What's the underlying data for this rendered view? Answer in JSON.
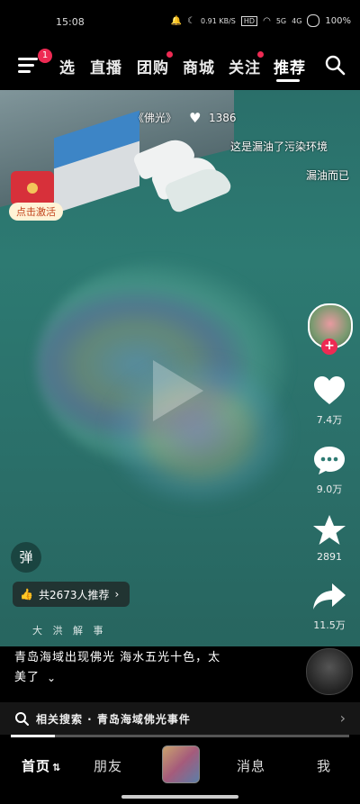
{
  "status_bar": {
    "time": "15:08",
    "speed": "0.91 KB/S",
    "signal_labels": [
      "HD",
      "5G",
      "4G"
    ],
    "battery": "100%"
  },
  "top_nav": {
    "menu_badge": "1",
    "tabs": [
      {
        "label": "选",
        "dot": false
      },
      {
        "label": "直播",
        "dot": false
      },
      {
        "label": "团购",
        "dot": true
      },
      {
        "label": "商城",
        "dot": false
      },
      {
        "label": "关注",
        "dot": true
      },
      {
        "label": "推荐",
        "dot": false,
        "active": true
      }
    ]
  },
  "video": {
    "danmu": [
      "《佛光》",
      "1386",
      "这是漏油了污染环境",
      "漏油而已"
    ],
    "activate_label": "点击激活",
    "danmu_button": "弹",
    "recommend_label": "共2673人推荐",
    "watermark": "大 洪 解 事"
  },
  "right_actions": {
    "like_count": "7.4万",
    "comment_count": "9.0万",
    "favorite_count": "2891",
    "share_count": "11.5万"
  },
  "caption": {
    "text_line1": "青岛海域出现佛光 海水五光十色，太",
    "text_line2": "美了"
  },
  "related_search": {
    "label": "相关搜索 · 青岛海域佛光事件"
  },
  "progress": 0.13,
  "bottom_nav": {
    "tabs": [
      "首页",
      "朋友",
      "消息",
      "我"
    ]
  },
  "colors": {
    "accent": "#ee2a53",
    "water": "#2d7a72",
    "background": "#000000"
  }
}
